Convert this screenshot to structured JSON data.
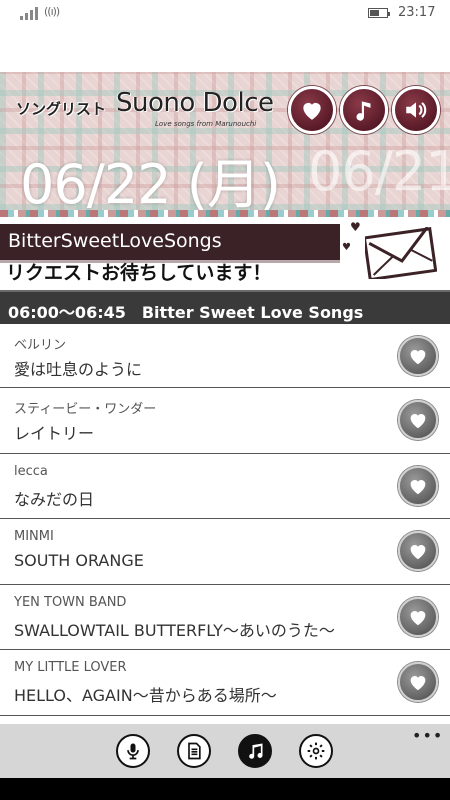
{
  "status_bar": {
    "time": "23:17",
    "icons": [
      "signal-icon",
      "wifi-icon",
      "battery-icon"
    ]
  },
  "header": {
    "title": "ソングリスト",
    "logo": "Suono Dolce",
    "logo_sub": "Love songs from Marunouchi",
    "buttons": [
      "heart-icon",
      "music-note-icon",
      "speaker-icon"
    ]
  },
  "dates": {
    "current": "06/22 (月)",
    "next": "06/21"
  },
  "banner": {
    "name": "BitterSweetLoveSongs",
    "message": "リクエストお待ちしています！"
  },
  "program": {
    "time_title": "06:00～06:45　Bitter Sweet Love Songs"
  },
  "songs": [
    {
      "artist": "ベルリン",
      "title": "愛は吐息のように"
    },
    {
      "artist": "スティービー・ワンダー",
      "title": "レイトリー"
    },
    {
      "artist": "lecca",
      "title": "なみだの日"
    },
    {
      "artist": "MINMI",
      "title": "SOUTH ORANGE"
    },
    {
      "artist": "YEN TOWN BAND",
      "title": "SWALLOWTAIL BUTTERFLY～あいのうた～"
    },
    {
      "artist": "MY LITTLE LOVER",
      "title": "HELLO、AGAIN～昔からある場所～"
    }
  ],
  "app_bar": {
    "buttons": [
      "microphone-icon",
      "document-icon",
      "music-note-icon",
      "gear-icon"
    ],
    "more": "•••"
  },
  "colors": {
    "accent": "#5a1a28",
    "banner_dark": "#3b2226",
    "program_bar": "#3a3a3a",
    "app_bar": "#d6d6d6"
  }
}
